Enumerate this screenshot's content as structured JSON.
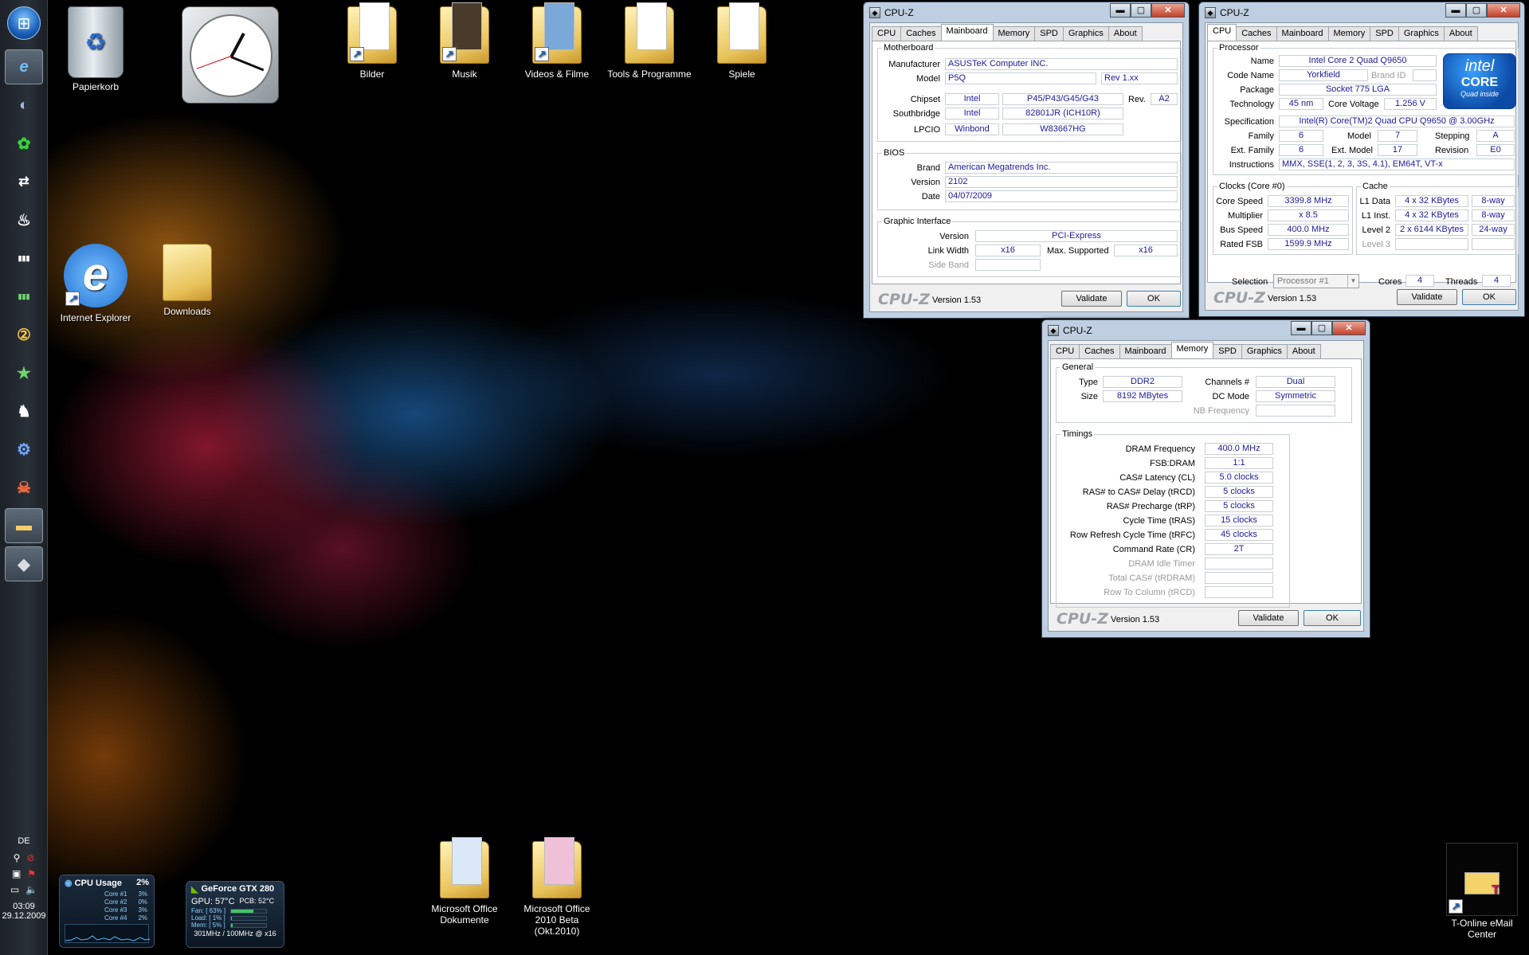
{
  "desktop": {
    "icons_top": [
      {
        "label": "Papierkorb",
        "type": "bin"
      },
      {
        "label": "Bilder",
        "type": "folder"
      },
      {
        "label": "Musik",
        "type": "folder"
      },
      {
        "label": "Videos & Filme",
        "type": "folder"
      },
      {
        "label": "Tools & Programme",
        "type": "folder"
      },
      {
        "label": "Spiele",
        "type": "folder"
      }
    ],
    "icons_mid": [
      {
        "label": "Internet Explorer"
      },
      {
        "label": "Downloads"
      }
    ],
    "icons_bottom": [
      {
        "label1": "Microsoft Office",
        "label2": "Dokumente"
      },
      {
        "label1": "Microsoft Office",
        "label2": "2010 Beta (Okt.2010)"
      }
    ],
    "email_center": {
      "label1": "T-Online eMail",
      "label2": "Center"
    }
  },
  "tray": {
    "lang": "DE",
    "time": "03:09",
    "date": "29.12.2009"
  },
  "tabs": [
    "CPU",
    "Caches",
    "Mainboard",
    "Memory",
    "SPD",
    "Graphics",
    "About"
  ],
  "window_title": "CPU-Z",
  "footer": {
    "logo": "CPU-Z",
    "version": "Version 1.53",
    "validate": "Validate",
    "ok": "OK"
  },
  "controls": {
    "minimize": "▬",
    "maximize": "▢",
    "close": "✕"
  },
  "mainboard": {
    "group_motherboard": "Motherboard",
    "manufacturer_label": "Manufacturer",
    "manufacturer": "ASUSTeK Computer INC.",
    "model_label": "Model",
    "model": "P5Q",
    "model_rev": "Rev 1.xx",
    "chipset_label": "Chipset",
    "chipset_vendor": "Intel",
    "chipset": "P45/P43/G45/G43",
    "rev_label": "Rev.",
    "chipset_rev": "A2",
    "southbridge_label": "Southbridge",
    "southbridge_vendor": "Intel",
    "southbridge": "82801JR (ICH10R)",
    "lpcio_label": "LPCIO",
    "lpcio_vendor": "Winbond",
    "lpcio": "W83667HG",
    "group_bios": "BIOS",
    "brand_label": "Brand",
    "brand": "American Megatrends Inc.",
    "version_label": "Version",
    "version": "2102",
    "date_label": "Date",
    "date": "04/07/2009",
    "group_graphic": "Graphic Interface",
    "gi_version_label": "Version",
    "gi_version": "PCI-Express",
    "link_width_label": "Link Width",
    "link_width": "x16",
    "max_supported_label": "Max. Supported",
    "max_supported": "x16",
    "side_band_label": "Side Band"
  },
  "cpu": {
    "group_processor": "Processor",
    "name_label": "Name",
    "name": "Intel Core 2 Quad Q9650",
    "code_name_label": "Code Name",
    "code_name": "Yorkfield",
    "brand_id_label": "Brand ID",
    "package_label": "Package",
    "package": "Socket 775 LGA",
    "technology_label": "Technology",
    "technology": "45 nm",
    "core_voltage_label": "Core Voltage",
    "core_voltage": "1.256 V",
    "specification_label": "Specification",
    "specification": "Intel(R) Core(TM)2 Quad CPU   Q9650  @ 3.00GHz",
    "family_label": "Family",
    "family": "6",
    "model_label": "Model",
    "model": "7",
    "stepping_label": "Stepping",
    "stepping": "A",
    "ext_family_label": "Ext. Family",
    "ext_family": "6",
    "ext_model_label": "Ext. Model",
    "ext_model": "17",
    "revision_label": "Revision",
    "revision": "E0",
    "instructions_label": "Instructions",
    "instructions": "MMX, SSE(1, 2, 3, 3S, 4.1), EM64T, VT-x",
    "group_clocks": "Clocks (Core #0)",
    "core_speed_label": "Core Speed",
    "core_speed": "3399.8 MHz",
    "multiplier_label": "Multiplier",
    "multiplier": "x 8.5",
    "bus_speed_label": "Bus Speed",
    "bus_speed": "400.0 MHz",
    "rated_fsb_label": "Rated FSB",
    "rated_fsb": "1599.9 MHz",
    "group_cache": "Cache",
    "l1_data_label": "L1 Data",
    "l1_data": "4 x 32 KBytes",
    "l1_data_way": "8-way",
    "l1_inst_label": "L1 Inst.",
    "l1_inst": "4 x 32 KBytes",
    "l1_inst_way": "8-way",
    "level2_label": "Level 2",
    "level2": "2 x 6144 KBytes",
    "level2_way": "24-way",
    "level3_label": "Level 3",
    "selection_label": "Selection",
    "selection": "Processor #1",
    "cores_label": "Cores",
    "cores": "4",
    "threads_label": "Threads",
    "threads": "4",
    "intel_logo": {
      "line1": "intel",
      "line2": "CORE",
      "line3": "Quad  inside"
    }
  },
  "memory": {
    "group_general": "General",
    "type_label": "Type",
    "type": "DDR2",
    "size_label": "Size",
    "size": "8192 MBytes",
    "channels_label": "Channels #",
    "channels": "Dual",
    "dc_mode_label": "DC Mode",
    "dc_mode": "Symmetric",
    "nb_freq_label": "NB Frequency",
    "group_timings": "Timings",
    "timings": [
      {
        "label": "DRAM Frequency",
        "value": "400.0 MHz",
        "dim": false
      },
      {
        "label": "FSB:DRAM",
        "value": "1:1",
        "dim": false
      },
      {
        "label": "CAS# Latency (CL)",
        "value": "5.0 clocks",
        "dim": false
      },
      {
        "label": "RAS# to CAS# Delay (tRCD)",
        "value": "5 clocks",
        "dim": false
      },
      {
        "label": "RAS# Precharge (tRP)",
        "value": "5 clocks",
        "dim": false
      },
      {
        "label": "Cycle Time (tRAS)",
        "value": "15 clocks",
        "dim": false
      },
      {
        "label": "Row Refresh Cycle Time (tRFC)",
        "value": "45 clocks",
        "dim": false
      },
      {
        "label": "Command Rate (CR)",
        "value": "2T",
        "dim": false
      },
      {
        "label": "DRAM Idle Timer",
        "value": "",
        "dim": true
      },
      {
        "label": "Total CAS# (tRDRAM)",
        "value": "",
        "dim": true
      },
      {
        "label": "Row To Column (tRCD)",
        "value": "",
        "dim": true
      }
    ]
  },
  "cpu_gadget": {
    "title": "CPU Usage",
    "total": "2%",
    "cores": [
      {
        "name": "Core #1",
        "value": "3%"
      },
      {
        "name": "Core #2",
        "value": "0%"
      },
      {
        "name": "Core #3",
        "value": "3%"
      },
      {
        "name": "Core #4",
        "value": "2%"
      }
    ]
  },
  "gpu_gadget": {
    "title": "GeForce GTX 280",
    "gpu_temp": "GPU: 57°C",
    "pcb_temp": "PCB: 52°C",
    "fan": "Fan: [ 63% ]",
    "fan_level": 63,
    "load": "Load: [ 1% ]",
    "load_level": 1,
    "mem": "Mem: [ 5% ]",
    "mem_level": 5,
    "clocks": "301MHz / 100MHz @ x16"
  }
}
